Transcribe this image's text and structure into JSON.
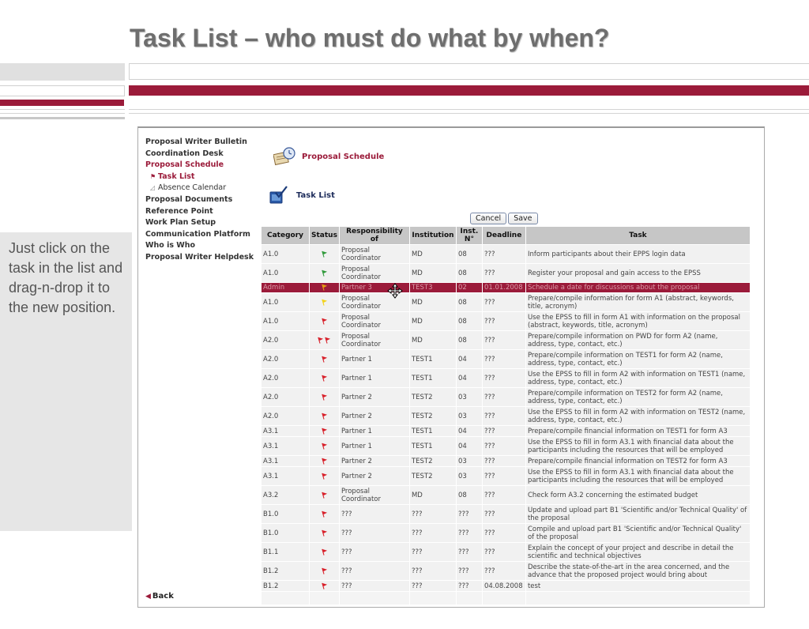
{
  "slide_title": "Task List – who must do what by when?",
  "side_note": "Just click on the task in the list and drag-n-drop it to the new position.",
  "colors": {
    "accent": "#9b1b3a",
    "header_bg": "#c6c6c6",
    "row_bg": "#f1f1f1",
    "selected_row_bg": "#9b1b3a"
  },
  "nav": {
    "items": [
      {
        "label": "Proposal Writer Bulletin"
      },
      {
        "label": "Coordination Desk"
      },
      {
        "label": "Proposal Schedule",
        "active": true
      },
      {
        "label": "Task List",
        "sub": true,
        "active": true,
        "icon": "flag-icon"
      },
      {
        "label": "Absence Calendar",
        "sub": true,
        "icon": "calendar-icon"
      },
      {
        "label": "Proposal Documents"
      },
      {
        "label": "Reference Point"
      },
      {
        "label": "Work Plan Setup"
      },
      {
        "label": "Communication Platform"
      },
      {
        "label": "Who is Who"
      },
      {
        "label": "Proposal Writer Helpdesk"
      }
    ],
    "back_label": "Back"
  },
  "main": {
    "schedule_heading": "Proposal Schedule",
    "tasklist_heading": "Task List",
    "cancel_label": "Cancel",
    "save_label": "Save",
    "columns": [
      "Category",
      "Status",
      "Responsibility of",
      "Institution",
      "Inst. N°",
      "Deadline",
      "Task"
    ],
    "rows": [
      {
        "category": "A1.0",
        "status": "green",
        "resp": "Proposal Coordinator",
        "inst": "MD",
        "num": "08",
        "deadline": "???",
        "task": "Inform participants about their EPPS login data"
      },
      {
        "category": "A1.0",
        "status": "green",
        "resp": "Proposal Coordinator",
        "inst": "MD",
        "num": "08",
        "deadline": "???",
        "task": "Register your proposal and gain access to the EPSS"
      },
      {
        "category": "Admin",
        "status": "orange",
        "resp": "Partner 3",
        "inst": "TEST3",
        "num": "02",
        "deadline": "01.01.2008",
        "task": "Schedule a date for discussions about the proposal",
        "selected": true
      },
      {
        "category": "A1.0",
        "status": "yellow",
        "resp": "Proposal Coordinator",
        "inst": "MD",
        "num": "08",
        "deadline": "???",
        "task": "Prepare/compile information for form A1 (abstract, keywords, title, acronym)"
      },
      {
        "category": "A1.0",
        "status": "red",
        "resp": "Proposal Coordinator",
        "inst": "MD",
        "num": "08",
        "deadline": "???",
        "task": "Use the EPSS to fill in form A1 with information on the proposal (abstract, keywords, title, acronym)"
      },
      {
        "category": "A2.0",
        "status": "red2",
        "resp": "Proposal Coordinator",
        "inst": "MD",
        "num": "08",
        "deadline": "???",
        "task": "Prepare/compile information on PWD for form A2 (name, address, type, contact, etc.)"
      },
      {
        "category": "A2.0",
        "status": "red",
        "resp": "Partner 1",
        "inst": "TEST1",
        "num": "04",
        "deadline": "???",
        "task": "Prepare/compile information on TEST1 for form A2 (name, address, type, contact, etc.)"
      },
      {
        "category": "A2.0",
        "status": "red",
        "resp": "Partner 1",
        "inst": "TEST1",
        "num": "04",
        "deadline": "???",
        "task": "Use the EPSS to fill in form A2 with information on TEST1 (name, address, type, contact, etc.)"
      },
      {
        "category": "A2.0",
        "status": "red",
        "resp": "Partner 2",
        "inst": "TEST2",
        "num": "03",
        "deadline": "???",
        "task": "Prepare/compile information on TEST2 for form A2 (name, address, type, contact, etc.)"
      },
      {
        "category": "A2.0",
        "status": "red",
        "resp": "Partner 2",
        "inst": "TEST2",
        "num": "03",
        "deadline": "???",
        "task": "Use the EPSS to fill in form A2 with information on TEST2 (name, address, type, contact, etc.)"
      },
      {
        "category": "A3.1",
        "status": "red",
        "resp": "Partner 1",
        "inst": "TEST1",
        "num": "04",
        "deadline": "???",
        "task": "Prepare/compile financial information on TEST1 for form A3",
        "short": true
      },
      {
        "category": "A3.1",
        "status": "red",
        "resp": "Partner 1",
        "inst": "TEST1",
        "num": "04",
        "deadline": "???",
        "task": "Use the EPSS to fill in form A3.1 with financial data about the participants including the resources that will be employed"
      },
      {
        "category": "A3.1",
        "status": "red",
        "resp": "Partner 2",
        "inst": "TEST2",
        "num": "03",
        "deadline": "???",
        "task": "Prepare/compile financial information on TEST2 for form A3",
        "short": true
      },
      {
        "category": "A3.1",
        "status": "red",
        "resp": "Partner 2",
        "inst": "TEST2",
        "num": "03",
        "deadline": "???",
        "task": "Use the EPSS to fill in form A3.1 with financial data about the participants including the resources that will be employed"
      },
      {
        "category": "A3.2",
        "status": "red",
        "resp": "Proposal Coordinator",
        "inst": "MD",
        "num": "08",
        "deadline": "???",
        "task": "Check form A3.2 concerning the estimated budget"
      },
      {
        "category": "B1.0",
        "status": "red",
        "resp": "???",
        "inst": "???",
        "num": "???",
        "deadline": "???",
        "task": "Update and upload part B1 'Scientific and/or Technical Quality' of the proposal"
      },
      {
        "category": "B1.0",
        "status": "red",
        "resp": "???",
        "inst": "???",
        "num": "???",
        "deadline": "???",
        "task": "Compile and upload part B1 'Scientific and/or Technical Quality' of the proposal"
      },
      {
        "category": "B1.1",
        "status": "red",
        "resp": "???",
        "inst": "???",
        "num": "???",
        "deadline": "???",
        "task": "Explain the concept of your project and describe in detail the scientific and technical objectives"
      },
      {
        "category": "B1.2",
        "status": "red",
        "resp": "???",
        "inst": "???",
        "num": "???",
        "deadline": "???",
        "task": "Describe the state-of-the-art in the area concerned, and the advance that the proposed project would bring about"
      },
      {
        "category": "B1.2",
        "status": "red",
        "resp": "???",
        "inst": "???",
        "num": "???",
        "deadline": "04.08.2008",
        "task": "test",
        "short": true
      }
    ]
  }
}
